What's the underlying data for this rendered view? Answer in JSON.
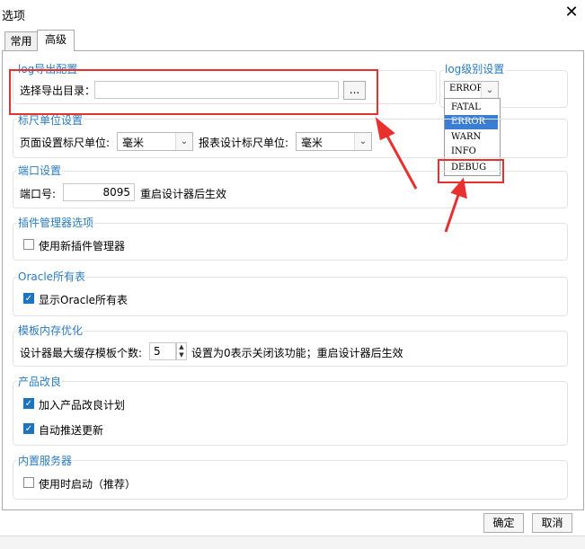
{
  "window": {
    "title": "选项",
    "close_glyph": "✕"
  },
  "tabs": [
    {
      "label": "常用",
      "active": false
    },
    {
      "label": "高级",
      "active": true
    }
  ],
  "export": {
    "title": "log导出配置",
    "dir_label": "选择导出目录：",
    "dir_value": "",
    "browse_label": "..."
  },
  "log_level": {
    "title": "log级别设置",
    "selected": "ERROR",
    "options": [
      "FATAL",
      "ERROR",
      "WARN",
      "INFO",
      "DEBUG"
    ]
  },
  "ruler": {
    "title": "标尺单位设置",
    "page_label": "页面设置标尺单位:",
    "page_value": "毫米",
    "report_label": "报表设计标尺单位:",
    "report_value": "毫米"
  },
  "port": {
    "title": "端口设置",
    "label": "端口号:",
    "value": "8095",
    "note": "重启设计器后生效"
  },
  "plugin": {
    "title": "插件管理器选项",
    "checkbox_label": "使用新插件管理器",
    "checked": false
  },
  "oracle": {
    "title": "Oracle所有表",
    "checkbox_label": "显示Oracle所有表",
    "checked": true
  },
  "cache": {
    "title": "模板内存优化",
    "label": "设计器最大缓存模板个数:",
    "value": "5",
    "note": "设置为0表示关闭该功能；重启设计器后生效"
  },
  "improve": {
    "title": "产品改良",
    "join_label": "加入产品改良计划",
    "join_checked": true,
    "autopush_label": "自动推送更新",
    "autopush_checked": true
  },
  "server": {
    "title": "内置服务器",
    "checkbox_label": "使用时启动（推荐）",
    "checked": false
  },
  "footer": {
    "ok_label": "确定",
    "cancel_label": "取消"
  },
  "colors": {
    "section_title": "#2a7bbf",
    "annotation_red": "#e8302e",
    "checkbox_blue": "#1e73be",
    "dropdown_selected": "#3b7ed1"
  }
}
